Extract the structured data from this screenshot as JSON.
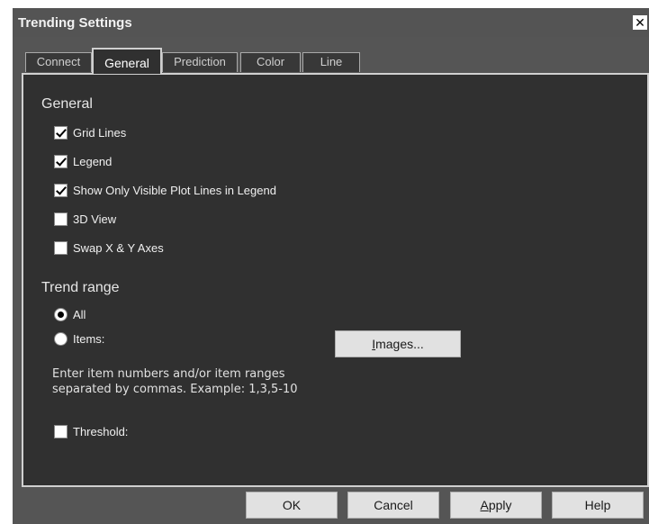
{
  "window": {
    "title": "Trending Settings",
    "close_glyph": "✕"
  },
  "tabs": [
    {
      "label": "Connect",
      "active": false
    },
    {
      "label": "General",
      "active": true
    },
    {
      "label": "Prediction",
      "active": false
    },
    {
      "label": "Color",
      "active": false
    },
    {
      "label": "Line",
      "active": false
    }
  ],
  "general": {
    "heading": "General",
    "options": [
      {
        "label": "Grid Lines",
        "checked": true
      },
      {
        "label": "Legend",
        "checked": true
      },
      {
        "label": "Show Only Visible Plot Lines in Legend",
        "checked": true
      },
      {
        "label": "3D View",
        "checked": false
      },
      {
        "label": "Swap X & Y Axes",
        "checked": false
      }
    ]
  },
  "trend_range": {
    "heading": "Trend range",
    "all_label": "All",
    "all_selected": true,
    "items_label": "Items:",
    "items_selected": false,
    "images_button_prefix": "I",
    "images_button_rest": "mages...",
    "help_line1": "Enter item numbers and/or item ranges",
    "help_line2": "separated by commas. Example: 1,3,5-10",
    "threshold_label": "Threshold:",
    "threshold_checked": false
  },
  "buttons": {
    "ok": "OK",
    "cancel": "Cancel",
    "apply_prefix": "A",
    "apply_rest": "pply",
    "help": "Help"
  },
  "colors": {
    "dialog_bg": "#555555",
    "panel_bg": "#303030",
    "button_bg": "#e1e1e1"
  }
}
